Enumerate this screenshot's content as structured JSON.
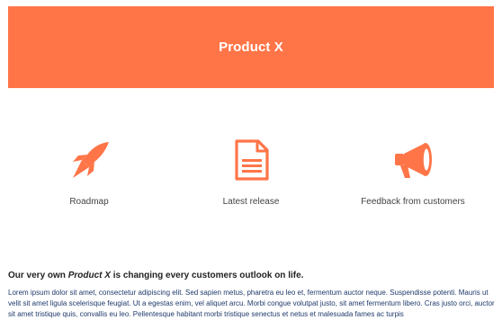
{
  "header": {
    "title": "Product X"
  },
  "features": [
    {
      "icon": "rocket-icon",
      "label": "Roadmap"
    },
    {
      "icon": "document-icon",
      "label": "Latest release"
    },
    {
      "icon": "megaphone-icon",
      "label": "Feedback from customers"
    }
  ],
  "intro": {
    "headline_before": "Our very own ",
    "headline_product": "Product X",
    "headline_after": " is changing every customers outlook on life.",
    "body": "Lorem ipsum dolor sit amet, consectetur adipiscing elit. Sed sapien metus, pharetra eu leo et, fermentum auctor neque. Suspendisse potenti. Mauris ut velit sit amet ligula scelerisque feugiat. Ut a egestas enim, vel aliquet arcu. Morbi congue volutpat justo, sit amet fermentum libero. Cras justo orci, auctor sit amet tristique quis, convallis eu leo. Pellentesque habitant morbi tristique senectus et netus et malesuada fames ac turpis"
  },
  "colors": {
    "accent": "#ff7548",
    "body_text": "#1f3a6b"
  }
}
